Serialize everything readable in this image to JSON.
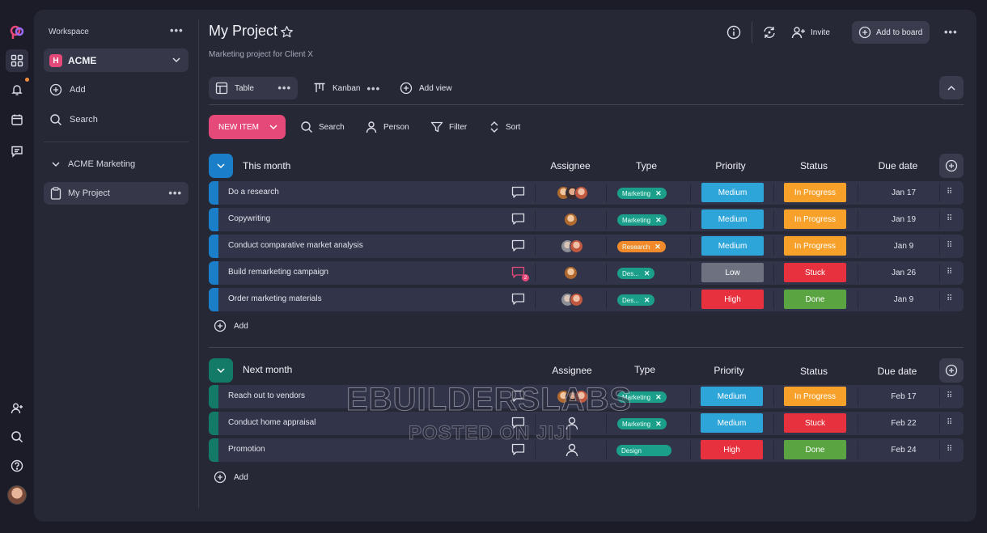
{
  "sidebar": {
    "workspace_label": "Workspace",
    "workspace": {
      "badge": "H",
      "name": "ACME"
    },
    "add_label": "Add",
    "search_label": "Search",
    "folder": "ACME Marketing",
    "project": "My Project"
  },
  "header": {
    "title": "My Project",
    "subtitle": "Marketing project for Client X",
    "invite": "Invite",
    "add_to_board": "Add to board"
  },
  "views": [
    {
      "label": "Table",
      "icon": "table-icon"
    },
    {
      "label": "Kanban",
      "icon": "kanban-icon"
    },
    {
      "label": "Add view",
      "icon": "plus-circle-icon"
    }
  ],
  "toolbar": {
    "new_item": "NEW ITEM",
    "search": "Search",
    "person": "Person",
    "filter": "Filter",
    "sort": "Sort"
  },
  "columns": {
    "assignee": "Assignee",
    "type": "Type",
    "priority": "Priority",
    "status": "Status",
    "due": "Due date"
  },
  "colors": {
    "accent": "#e5497a",
    "group1": "#1a7fc8",
    "group2": "#127a66",
    "medium": "#2ea5d8",
    "low": "#6e7280",
    "high": "#e8313f",
    "in_progress": "#f7a12b",
    "stuck": "#e8313f",
    "done": "#5aa541",
    "marketing": "#1b9e8a",
    "research": "#f08a2b",
    "design": "#1b9e8a"
  },
  "groups": [
    {
      "title": "This month",
      "add_label": "Add",
      "rows": [
        {
          "name": "Do a research",
          "type": "Marketing",
          "priority": "Medium",
          "status": "In Progress",
          "due": "Jan 17",
          "comments": ""
        },
        {
          "name": "Copywriting",
          "type": "Marketing",
          "priority": "Medium",
          "status": "In Progress",
          "due": "Jan 19",
          "comments": ""
        },
        {
          "name": "Conduct comparative market analysis",
          "type": "Research",
          "priority": "Medium",
          "status": "In Progress",
          "due": "Jan 9",
          "comments": ""
        },
        {
          "name": "Build remarketing campaign",
          "type": "Des...",
          "priority": "Low",
          "status": "Stuck",
          "due": "Jan 26",
          "comments": "2"
        },
        {
          "name": "Order marketing materials",
          "type": "Des...",
          "priority": "High",
          "status": "Done",
          "due": "Jan 9",
          "comments": ""
        }
      ]
    },
    {
      "title": "Next month",
      "add_label": "Add",
      "rows": [
        {
          "name": "Reach out to vendors",
          "type": "Marketing",
          "priority": "Medium",
          "status": "In Progress",
          "due": "Feb 17",
          "comments": ""
        },
        {
          "name": "Conduct home appraisal",
          "type": "Marketing",
          "priority": "Medium",
          "status": "Stuck",
          "due": "Feb 22",
          "comments": ""
        },
        {
          "name": "Promotion",
          "type": "Design",
          "priority": "High",
          "status": "Done",
          "due": "Feb 24",
          "comments": ""
        }
      ]
    }
  ],
  "watermark": {
    "line1": "EBUILDERSLABS",
    "line2": "POSTED ON JIJI"
  }
}
